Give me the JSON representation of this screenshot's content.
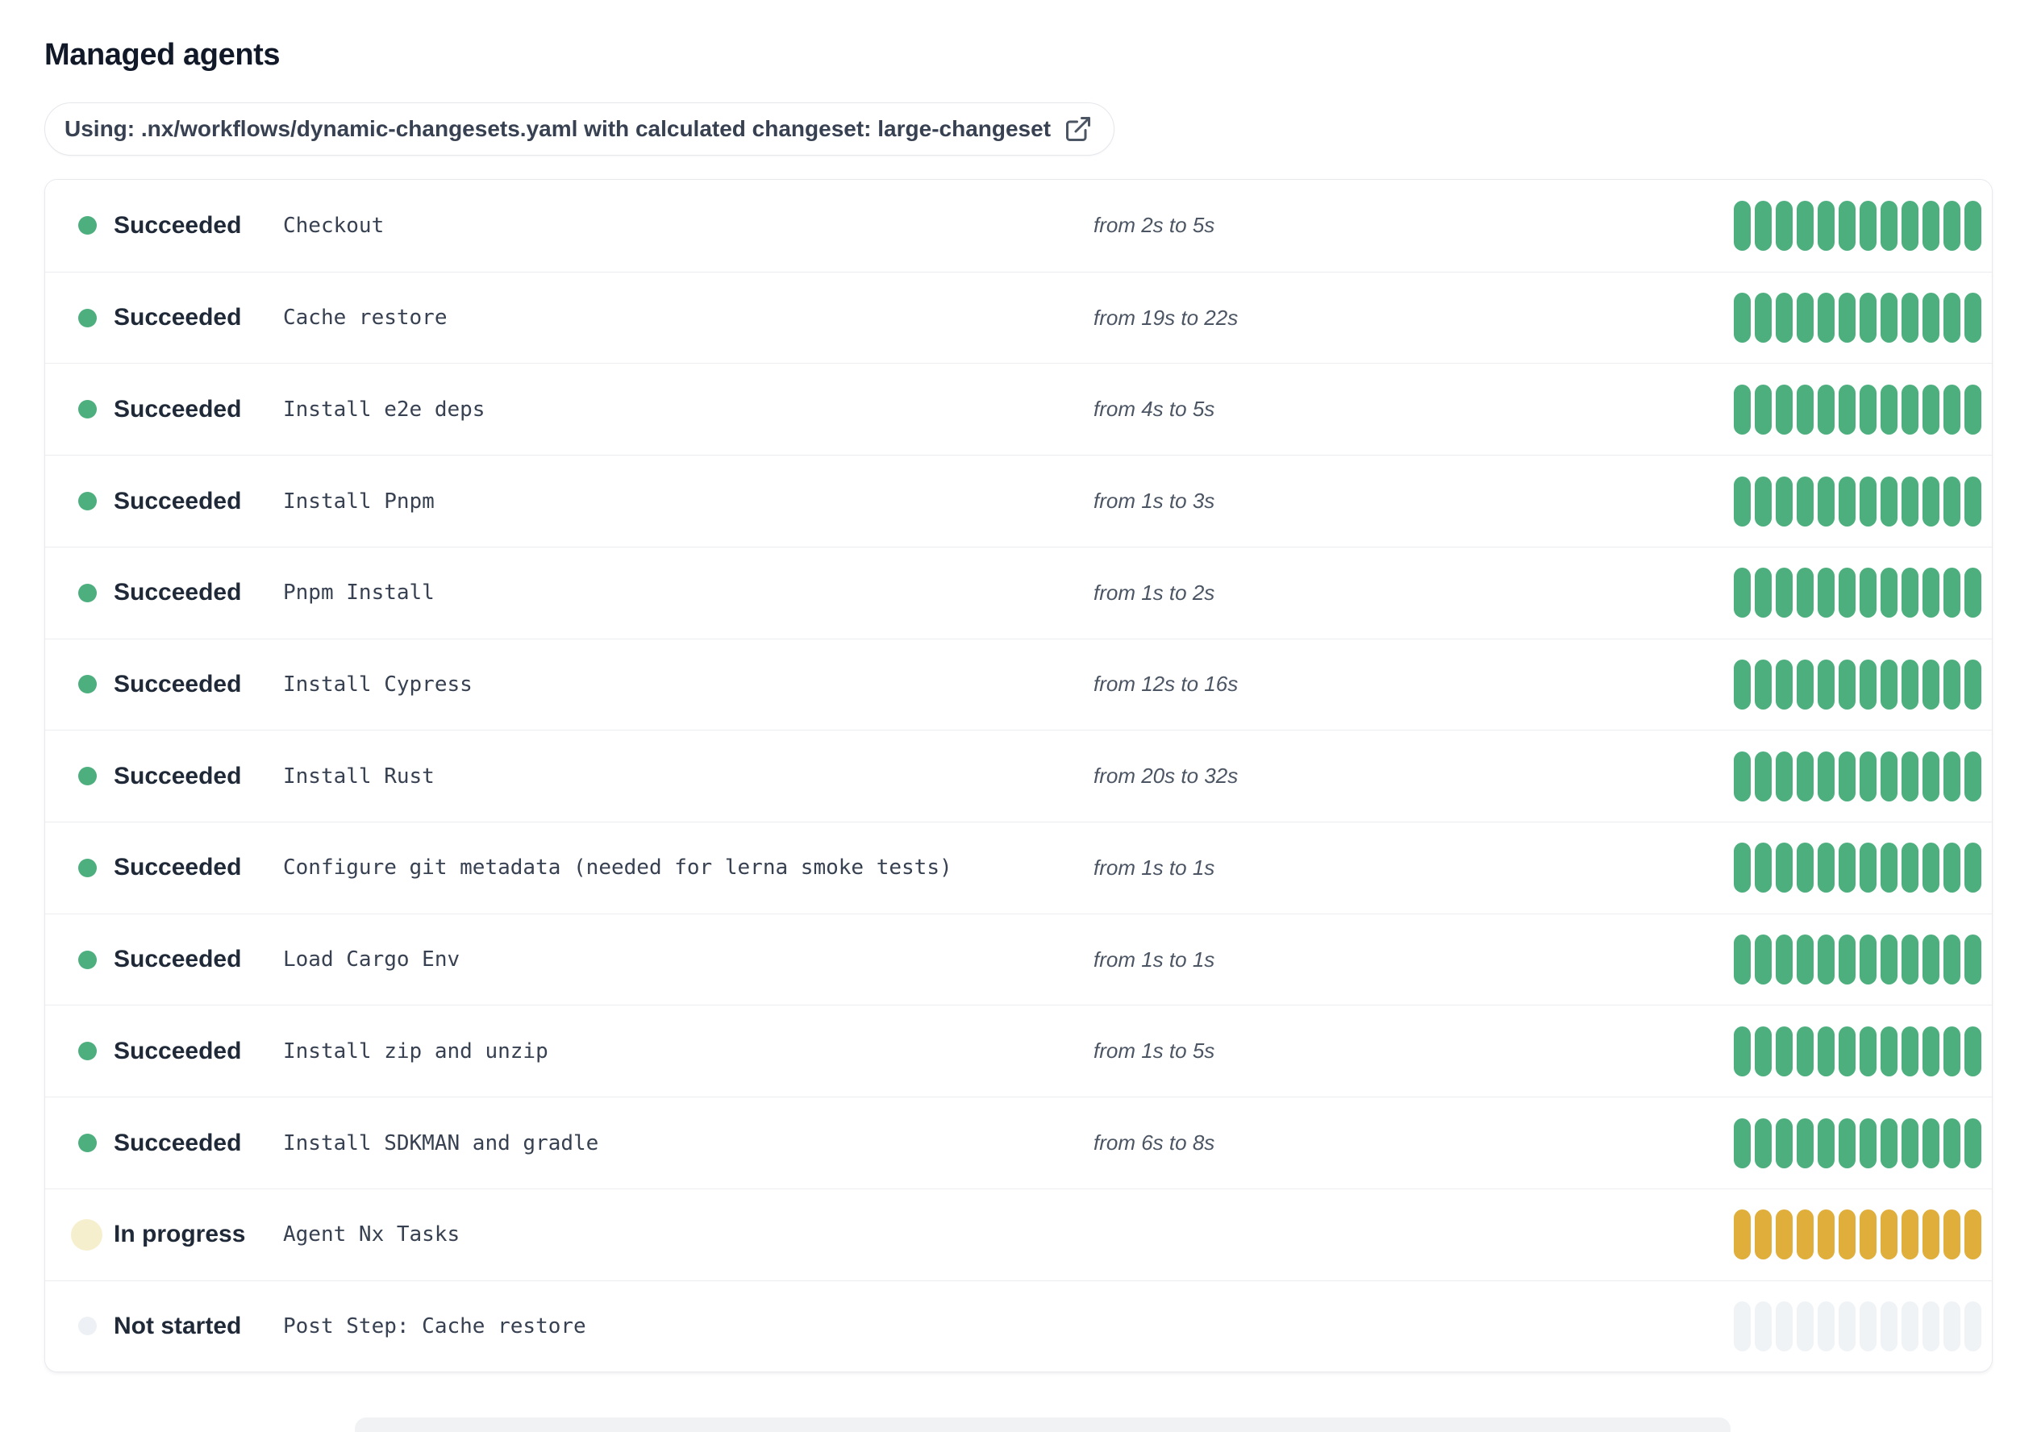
{
  "page": {
    "title": "Managed agents"
  },
  "workflow_pill": {
    "label": "Using: .nx/workflows/dynamic-changesets.yaml with calculated changeset: large-changeset",
    "icon": "external-link-icon"
  },
  "colors": {
    "title_text": "#111827",
    "status_text": "#1f2937",
    "name_text": "#374151",
    "duration_text": "#4b5563",
    "card_border": "#e7e9ed",
    "divider": "#ebedf0",
    "succeeded": "#4dae7e",
    "in_progress_bar": "#e0ae3b",
    "in_progress_dot": "#d6a32b",
    "in_progress_halo": "#f6efcd",
    "not_started_bar": "#f0f3f6",
    "not_started_dot": "#edf0f4"
  },
  "agents": {
    "segments_per_row": 12,
    "rows": [
      {
        "status": "Succeeded",
        "state": "succeeded",
        "name": "Checkout",
        "duration": "from 2s to 5s"
      },
      {
        "status": "Succeeded",
        "state": "succeeded",
        "name": "Cache restore",
        "duration": "from 19s to 22s"
      },
      {
        "status": "Succeeded",
        "state": "succeeded",
        "name": "Install e2e deps",
        "duration": "from 4s to 5s"
      },
      {
        "status": "Succeeded",
        "state": "succeeded",
        "name": "Install Pnpm",
        "duration": "from 1s to 3s"
      },
      {
        "status": "Succeeded",
        "state": "succeeded",
        "name": "Pnpm Install",
        "duration": "from 1s to 2s"
      },
      {
        "status": "Succeeded",
        "state": "succeeded",
        "name": "Install Cypress",
        "duration": "from 12s to 16s"
      },
      {
        "status": "Succeeded",
        "state": "succeeded",
        "name": "Install Rust",
        "duration": "from 20s to 32s"
      },
      {
        "status": "Succeeded",
        "state": "succeeded",
        "name": "Configure git metadata (needed for lerna smoke tests)",
        "duration": "from 1s to 1s"
      },
      {
        "status": "Succeeded",
        "state": "succeeded",
        "name": "Load Cargo Env",
        "duration": "from 1s to 1s"
      },
      {
        "status": "Succeeded",
        "state": "succeeded",
        "name": "Install zip and unzip",
        "duration": "from 1s to 5s"
      },
      {
        "status": "Succeeded",
        "state": "succeeded",
        "name": "Install SDKMAN and gradle",
        "duration": "from 6s to 8s"
      },
      {
        "status": "In progress",
        "state": "in-progress",
        "name": "Agent Nx Tasks",
        "duration": ""
      },
      {
        "status": "Not started",
        "state": "not-started",
        "name": "Post Step: Cache restore",
        "duration": ""
      }
    ]
  }
}
